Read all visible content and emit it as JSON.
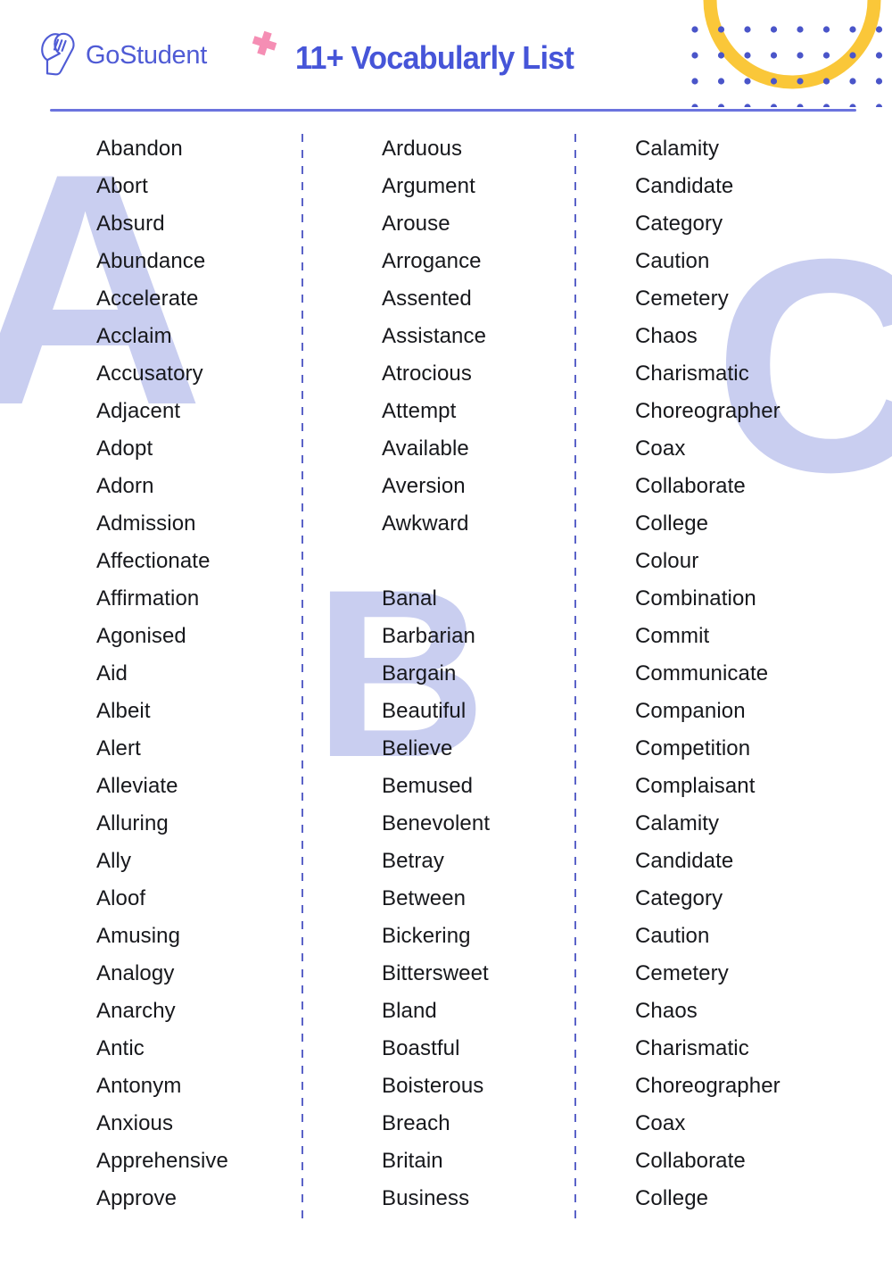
{
  "header": {
    "brand_name": "GoStudent",
    "title": "11+ Vocabularly List",
    "logo_icon": "gostudent-graduation-cap-icon",
    "cross_icon": "pink-cross-decoration-icon",
    "dotgrid_icon": "dot-grid-decoration",
    "arc_icon": "yellow-arc-decoration"
  },
  "colors": {
    "brand_blue": "#4F5BD5",
    "title_blue": "#4655D8",
    "rule_blue": "#6B73DE",
    "watermark_lavender": "#C9CEF0",
    "accent_pink": "#F58EB4",
    "accent_yellow": "#FAC739",
    "dot_blue": "#4A55C9",
    "word_text": "#17181C"
  },
  "watermarks": [
    {
      "letter": "A",
      "name": "watermark-letter-a"
    },
    {
      "letter": "B",
      "name": "watermark-letter-b"
    },
    {
      "letter": "C",
      "name": "watermark-letter-c"
    }
  ],
  "columns": [
    {
      "id": "column-a",
      "words": [
        "Abandon",
        "Abort",
        "Absurd",
        "Abundance",
        "Accelerate",
        "Acclaim",
        "Accusatory",
        "Adjacent",
        "Adopt",
        "Adorn",
        "Admission",
        "Affectionate",
        "Affirmation",
        "Agonised",
        "Aid",
        "Albeit",
        "Alert",
        "Alleviate",
        "Alluring",
        "Ally",
        "Aloof",
        "Amusing",
        "Analogy",
        "Anarchy",
        "Antic",
        "Antonym",
        "Anxious",
        "Apprehensive",
        "Approve"
      ]
    },
    {
      "id": "column-a2-b",
      "words": [
        "Arduous",
        "Argument",
        "Arouse",
        "Arrogance",
        "Assented",
        "Assistance",
        "Atrocious",
        "Attempt",
        "Available",
        "Aversion",
        "Awkward",
        "",
        "Banal",
        "Barbarian",
        "Bargain",
        "Beautiful",
        "Believe",
        "Bemused",
        "Benevolent",
        "Betray",
        "Between",
        "Bickering",
        "Bittersweet",
        "Bland",
        "Boastful",
        "Boisterous",
        "Breach",
        "Britain",
        "Business"
      ]
    },
    {
      "id": "column-c",
      "words": [
        "Calamity",
        "Candidate",
        "Category",
        "Caution",
        "Cemetery",
        "Chaos",
        "Charismatic",
        "Choreographer",
        "Coax",
        "Collaborate",
        "College",
        "Colour",
        "Combination",
        "Commit",
        "Communicate",
        "Companion",
        "Competition",
        "Complaisant",
        "Calamity",
        "Candidate",
        "Category",
        "Caution",
        "Cemetery",
        "Chaos",
        "Charismatic",
        "Choreographer",
        "Coax",
        "Collaborate",
        "College"
      ]
    }
  ]
}
